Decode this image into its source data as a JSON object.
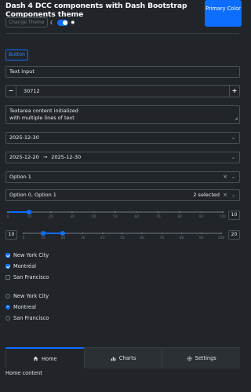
{
  "header": {
    "title": "Dash 4 DCC components with Dash Bootstrap Components theme",
    "primary_button": "Primary Color",
    "change_theme_label": "Change Theme",
    "moon_icon": "moon-icon",
    "sun_icon": "sun-icon"
  },
  "button": {
    "label": "Button"
  },
  "text_input": {
    "value": "Text input"
  },
  "number_input": {
    "value": "30712",
    "minus": "−",
    "plus": "+"
  },
  "textarea": {
    "line1": "Textarea content initialized",
    "line2": "with multiple lines of text"
  },
  "date_picker": {
    "value": "2025-12-30"
  },
  "date_range": {
    "start": "2025-12-20",
    "arrow": "→",
    "end": "2025-12-30"
  },
  "dropdown_single": {
    "value": "Option 1"
  },
  "dropdown_multi": {
    "value": "Option 0, Option 1",
    "count_label": "2 selected"
  },
  "slider": {
    "ticks": [
      "0",
      "10",
      "20",
      "30",
      "40",
      "50",
      "60",
      "70",
      "80",
      "90",
      "100"
    ],
    "value": 10,
    "value_label": "10"
  },
  "range_slider": {
    "ticks": [
      "0",
      "10",
      "20",
      "30",
      "40",
      "50",
      "60",
      "70",
      "80",
      "90",
      "100"
    ],
    "low": 10,
    "high": 20,
    "low_label": "10",
    "high_label": "20"
  },
  "checklist": [
    {
      "label": "New York City",
      "checked": true
    },
    {
      "label": "Montréal",
      "checked": true
    },
    {
      "label": "San Francisco",
      "checked": false
    }
  ],
  "radio": [
    {
      "label": "New York City",
      "selected": false
    },
    {
      "label": "Montreal",
      "selected": true
    },
    {
      "label": "San Francisco",
      "selected": false
    }
  ],
  "tabs": [
    {
      "label": "Home",
      "icon": "home-icon",
      "active": true
    },
    {
      "label": "Charts",
      "icon": "bar-chart-icon",
      "active": false
    },
    {
      "label": "Settings",
      "icon": "gear-icon",
      "active": false
    }
  ],
  "tab_content": "Home content",
  "colors": {
    "accent": "#0d6efd",
    "background": "#212529",
    "border": "#495057"
  }
}
